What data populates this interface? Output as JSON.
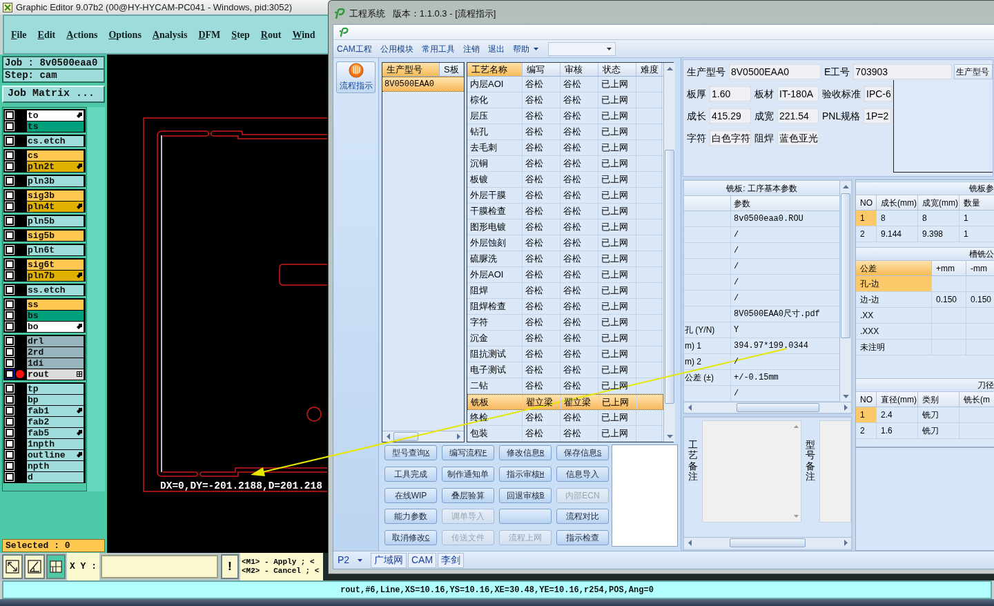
{
  "editor": {
    "title": "Graphic Editor 9.07b2 (00@HY-HYCAM-PC041 - Windows, pid:3052)",
    "menu": [
      "File",
      "Edit",
      "Actions",
      "Options",
      "Analysis",
      "DFM",
      "Step",
      "Rout",
      "Wind"
    ],
    "job": "Job : 8v0500eaa0",
    "step": "Step: cam",
    "matrix_button": "Job Matrix ...",
    "layer_groups": [
      {
        "layers": [
          {
            "name": "to",
            "color": "#ffffff",
            "kind": "arrow",
            "checked": false,
            "active": false
          },
          {
            "name": "ts",
            "color": "#00a07c",
            "kind": "plain",
            "checked": false,
            "active": false
          }
        ]
      },
      {
        "layers": [
          {
            "name": "cs.etch",
            "color": "#a0dcdc",
            "kind": "plain",
            "checked": false,
            "active": false
          }
        ]
      },
      {
        "layers": [
          {
            "name": "cs",
            "color": "#ffc850",
            "kind": "plain",
            "checked": false,
            "active": false
          },
          {
            "name": "pln2t",
            "color": "#e0b000",
            "kind": "arrow",
            "checked": false,
            "active": false
          }
        ]
      },
      {
        "layers": [
          {
            "name": "pln3b",
            "color": "#a0dcdc",
            "kind": "plain",
            "checked": false,
            "active": false
          }
        ]
      },
      {
        "layers": [
          {
            "name": "sig3b",
            "color": "#ffc850",
            "kind": "plain",
            "checked": false,
            "active": false
          },
          {
            "name": "pln4t",
            "color": "#e0b000",
            "kind": "arrow",
            "checked": false,
            "active": false
          }
        ]
      },
      {
        "layers": [
          {
            "name": "pln5b",
            "color": "#a0dcdc",
            "kind": "plain",
            "checked": false,
            "active": false
          }
        ]
      },
      {
        "layers": [
          {
            "name": "sig5b",
            "color": "#ffc850",
            "kind": "plain",
            "checked": false,
            "active": false
          }
        ]
      },
      {
        "layers": [
          {
            "name": "pln6t",
            "color": "#a0dcdc",
            "kind": "plain",
            "checked": false,
            "active": false
          }
        ]
      },
      {
        "layers": [
          {
            "name": "sig6t",
            "color": "#ffc850",
            "kind": "plain",
            "checked": false,
            "active": false
          },
          {
            "name": "pln7b",
            "color": "#e0b000",
            "kind": "arrow",
            "checked": false,
            "active": false
          }
        ]
      },
      {
        "layers": [
          {
            "name": "ss.etch",
            "color": "#a0dcdc",
            "kind": "plain",
            "checked": false,
            "active": false
          }
        ]
      },
      {
        "layers": [
          {
            "name": "ss",
            "color": "#ffc850",
            "kind": "plain",
            "checked": false,
            "active": false
          },
          {
            "name": "bs",
            "color": "#00a07c",
            "kind": "plain",
            "checked": false,
            "active": false
          },
          {
            "name": "bo",
            "color": "#ffffff",
            "kind": "arrow",
            "checked": false,
            "active": false
          }
        ]
      },
      {
        "layers": [
          {
            "name": "drl",
            "color": "#98b4bc",
            "kind": "plain",
            "checked": false,
            "active": false
          },
          {
            "name": "2rd",
            "color": "#98b4bc",
            "kind": "plain",
            "checked": false,
            "active": false
          },
          {
            "name": "1di",
            "color": "#98b4bc",
            "kind": "plain",
            "checked": false,
            "active": false
          },
          {
            "name": "rout",
            "color": "#dcdcdc",
            "kind": "grid",
            "checked": false,
            "active": true
          }
        ]
      },
      {
        "layers": [
          {
            "name": "tp",
            "color": "#a0dcdc",
            "kind": "plain",
            "checked": false,
            "active": false
          },
          {
            "name": "bp",
            "color": "#a0dcdc",
            "kind": "plain",
            "checked": false,
            "active": false
          },
          {
            "name": "fab1",
            "color": "#a0dcdc",
            "kind": "arrow",
            "checked": false,
            "active": false
          },
          {
            "name": "fab2",
            "color": "#a0dcdc",
            "kind": "plain",
            "checked": false,
            "active": false
          },
          {
            "name": "fab5",
            "color": "#a0dcdc",
            "kind": "arrow",
            "checked": false,
            "active": false
          },
          {
            "name": "1npth",
            "color": "#a0dcdc",
            "kind": "plain",
            "checked": false,
            "active": false
          },
          {
            "name": "outline",
            "color": "#a0dcdc",
            "kind": "arrow",
            "checked": false,
            "active": false
          },
          {
            "name": "npth",
            "color": "#a0dcdc",
            "kind": "plain",
            "checked": false,
            "active": false
          },
          {
            "name": "d",
            "color": "#a0dcdc",
            "kind": "plain",
            "checked": false,
            "active": false
          }
        ]
      }
    ],
    "measure": "DX=0,DY=-201.2188,D=201.218",
    "selected_count": "Selected : 0",
    "xy_label": "X Y :",
    "alert_button": "!",
    "hints": [
      "<M1> - Apply ; <",
      "<M2> - Cancel ; <"
    ],
    "status": "rout,#6,Line,XS=10.16,YS=10.16,XE=30.48,YE=10.16,r254,POS,Ang=0"
  },
  "cam": {
    "title": "工程系统   版本：1.1.0.3 - [流程指示]",
    "menu": [
      {
        "label": "CAM工程"
      },
      {
        "label": "公用模块"
      },
      {
        "label": "常用工具"
      },
      {
        "label": "注销"
      },
      {
        "label": "退出"
      },
      {
        "label": "帮助",
        "dropdown": true
      }
    ],
    "nav": [
      {
        "label": "流程指示",
        "selected": true
      }
    ],
    "models": {
      "columns": [
        {
          "label": "生产型号",
          "selected": true
        },
        {
          "label": "S板",
          "selected": false
        }
      ],
      "rows": [
        {
          "cells": [
            "8V0500EAA0"
          ],
          "selected": true
        }
      ]
    },
    "processes": {
      "columns": [
        {
          "label": "工艺名称",
          "selected": true
        },
        {
          "label": "编写",
          "selected": false
        },
        {
          "label": "审核",
          "selected": false
        },
        {
          "label": "状态",
          "selected": false
        },
        {
          "label": "难度",
          "selected": false
        }
      ],
      "rows": [
        {
          "cells": [
            "内层AOI",
            "谷松",
            "谷松",
            "已上网"
          ],
          "selected": false
        },
        {
          "cells": [
            "棕化",
            "谷松",
            "谷松",
            "已上网"
          ],
          "selected": false
        },
        {
          "cells": [
            "层压",
            "谷松",
            "谷松",
            "已上网"
          ],
          "selected": false
        },
        {
          "cells": [
            "钻孔",
            "谷松",
            "谷松",
            "已上网"
          ],
          "selected": false
        },
        {
          "cells": [
            "去毛刺",
            "谷松",
            "谷松",
            "已上网"
          ],
          "selected": false
        },
        {
          "cells": [
            "沉铜",
            "谷松",
            "谷松",
            "已上网"
          ],
          "selected": false
        },
        {
          "cells": [
            "板镀",
            "谷松",
            "谷松",
            "已上网"
          ],
          "selected": false
        },
        {
          "cells": [
            "外层干膜",
            "谷松",
            "谷松",
            "已上网"
          ],
          "selected": false
        },
        {
          "cells": [
            "干膜检查",
            "谷松",
            "谷松",
            "已上网"
          ],
          "selected": false
        },
        {
          "cells": [
            "图形电镀",
            "谷松",
            "谷松",
            "已上网"
          ],
          "selected": false
        },
        {
          "cells": [
            "外层蚀刻",
            "谷松",
            "谷松",
            "已上网"
          ],
          "selected": false
        },
        {
          "cells": [
            "硫脲洗",
            "谷松",
            "谷松",
            "已上网"
          ],
          "selected": false
        },
        {
          "cells": [
            "外层AOI",
            "谷松",
            "谷松",
            "已上网"
          ],
          "selected": false
        },
        {
          "cells": [
            "阻焊",
            "谷松",
            "谷松",
            "已上网"
          ],
          "selected": false
        },
        {
          "cells": [
            "阻焊检查",
            "谷松",
            "谷松",
            "已上网"
          ],
          "selected": false
        },
        {
          "cells": [
            "字符",
            "谷松",
            "谷松",
            "已上网"
          ],
          "selected": false
        },
        {
          "cells": [
            "沉金",
            "谷松",
            "谷松",
            "已上网"
          ],
          "selected": false
        },
        {
          "cells": [
            "阻抗测试",
            "谷松",
            "谷松",
            "已上网"
          ],
          "selected": false
        },
        {
          "cells": [
            "电子测试",
            "谷松",
            "谷松",
            "已上网"
          ],
          "selected": false
        },
        {
          "cells": [
            "二钻",
            "谷松",
            "谷松",
            "已上网"
          ],
          "selected": false
        },
        {
          "cells": [
            "铣板",
            "翟立梁",
            "翟立梁",
            "已上网"
          ],
          "selected": true
        },
        {
          "cells": [
            "终检",
            "谷松",
            "谷松",
            "已上网"
          ],
          "selected": false
        },
        {
          "cells": [
            "包装",
            "谷松",
            "谷松",
            "已上网"
          ],
          "selected": false
        }
      ]
    },
    "buttons": [
      {
        "label": "型号查询",
        "hotkey": "X",
        "disabled": false
      },
      {
        "label": "编写流程",
        "hotkey": "F",
        "disabled": false
      },
      {
        "label": "修改信息",
        "hotkey": "R",
        "disabled": false
      },
      {
        "label": "保存信息",
        "hotkey": "S",
        "disabled": false
      },
      {
        "label": "工具完成",
        "disabled": false
      },
      {
        "label": "制作通知单",
        "disabled": false
      },
      {
        "label": "指示审核",
        "hotkey": "H",
        "disabled": false
      },
      {
        "label": "信息导入",
        "disabled": false
      },
      {
        "label": "在线WIP",
        "disabled": false
      },
      {
        "label": "叠层验算",
        "disabled": false
      },
      {
        "label": "回退审核",
        "hotkey": "B",
        "disabled": false
      },
      {
        "label": "内部ECN",
        "disabled": true
      },
      {
        "label": "能力参数",
        "disabled": false
      },
      {
        "label": "调单导入",
        "disabled": true
      },
      {
        "disabled": false
      },
      {
        "label": "流程对比",
        "disabled": false
      },
      {
        "label": "取消修改",
        "hotkey": "C",
        "disabled": false
      },
      {
        "label": "传送文件",
        "disabled": true
      },
      {
        "label": "流程上网",
        "disabled": true
      },
      {
        "label": "指示检查",
        "disabled": false
      }
    ],
    "info": [
      [
        {
          "label": "生产型号",
          "value": "8V0500EAA0"
        },
        {
          "label": "E工号",
          "value": "703903"
        }
      ],
      [
        {
          "label": "板厚",
          "value": "1.60"
        },
        {
          "label": "板材",
          "value": "IT-180A"
        },
        {
          "label": "验收标准",
          "value": "IPC-6"
        }
      ],
      [
        {
          "label": "成长",
          "value": "415.29"
        },
        {
          "label": "成宽",
          "value": "221.54"
        },
        {
          "label": "PNL规格",
          "value": "1P=2"
        }
      ],
      [
        {
          "label": "字符",
          "value": "白色字符"
        },
        {
          "label": "阻焊",
          "value": "蓝色亚光"
        }
      ]
    ],
    "info_side_header": "生产型号",
    "params": {
      "title": "铣板: 工序基本参数",
      "column": "参数",
      "rows": [
        {
          "value": "8v0500eaa0.ROU"
        },
        {
          "value": "/"
        },
        {
          "value": "/"
        },
        {
          "value": "/"
        },
        {
          "value": "/"
        },
        {
          "value": "/"
        },
        {
          "value": "8V0500EAA0尺寸.pdf"
        },
        {
          "name": "孔 (Y/N)",
          "value": "Y"
        },
        {
          "name": "m) 1",
          "value": "394.97*199.0344"
        },
        {
          "name": "m) 2",
          "value": "/"
        },
        {
          "name": "公差 (±)",
          "value": "+/-0.15mm"
        },
        {
          "value": "/"
        }
      ]
    },
    "mill_sizes": {
      "title": "铣板参",
      "columns": [
        {
          "label": "NO",
          "selected": false
        },
        {
          "label": "成长(mm)",
          "selected": false
        },
        {
          "label": "成宽(mm)",
          "selected": false
        },
        {
          "label": "数量",
          "selected": false
        }
      ],
      "rows": [
        {
          "cells": [
            "1",
            "8",
            "8",
            "1"
          ],
          "selected": true
        },
        {
          "cells": [
            "2",
            "9.144",
            "9.398",
            "1"
          ],
          "selected": false
        }
      ]
    },
    "tolerances": {
      "title": "槽铣公",
      "columns": [
        {
          "label": "公差",
          "selected": true
        },
        {
          "label": "+mm",
          "selected": false
        },
        {
          "label": "-mm",
          "selected": false
        }
      ],
      "rows": [
        {
          "cells": [
            "孔-边"
          ],
          "selected": true
        },
        {
          "cells": [
            "边-边",
            "0.150",
            "0.150"
          ],
          "selected": false
        },
        {
          "cells": [
            ".XX"
          ],
          "selected": false
        },
        {
          "cells": [
            ".XXX"
          ],
          "selected": false
        },
        {
          "cells": [
            "未注明"
          ],
          "selected": false
        }
      ]
    },
    "tools": {
      "title": "刀径",
      "columns": [
        {
          "label": "NO",
          "selected": false
        },
        {
          "label": "直径(mm)",
          "selected": false
        },
        {
          "label": "类别",
          "selected": false
        },
        {
          "label": "铣长(m",
          "selected": false
        }
      ],
      "rows": [
        {
          "cells": [
            "1",
            "2.4",
            "铣刀"
          ],
          "selected": true
        },
        {
          "cells": [
            "2",
            "1.6",
            "铣刀"
          ],
          "selected": false
        }
      ]
    },
    "remarks": [
      "工艺备注",
      "型号备注"
    ],
    "footer": {
      "page": "P2",
      "tabs": [
        "广域网",
        "CAM",
        "李剑"
      ]
    }
  }
}
